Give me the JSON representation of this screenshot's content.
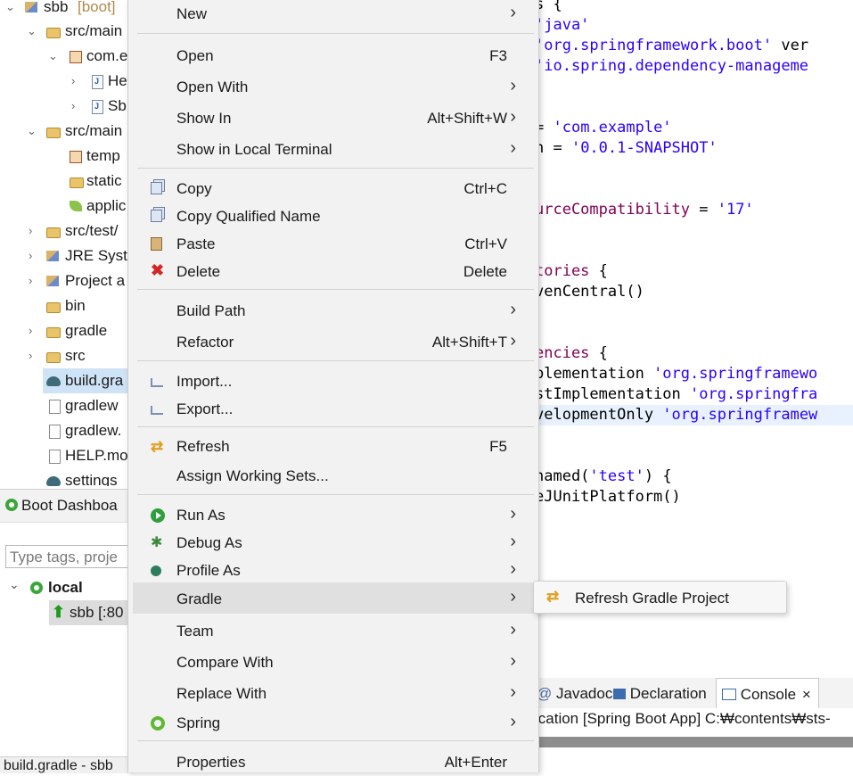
{
  "explorer": {
    "rows": [
      {
        "label": "sbb",
        "decoration": "[boot]"
      },
      {
        "label": "src/main"
      },
      {
        "label": "com.e"
      },
      {
        "label": "He"
      },
      {
        "label": "Sb"
      },
      {
        "label": "src/main"
      },
      {
        "label": "temp"
      },
      {
        "label": "static"
      },
      {
        "label": "applic"
      },
      {
        "label": "src/test/"
      },
      {
        "label": "JRE Syste"
      },
      {
        "label": "Project a"
      },
      {
        "label": "bin"
      },
      {
        "label": "gradle"
      },
      {
        "label": "src"
      },
      {
        "label": "build.gra"
      },
      {
        "label": "gradlew"
      },
      {
        "label": "gradlew."
      },
      {
        "label": "HELP.mo"
      },
      {
        "label": "settings"
      }
    ]
  },
  "boot_dashboard": {
    "title": "Boot Dashboa",
    "search_placeholder": "Type tags, proje",
    "local_label": "local",
    "app_label": "sbb [:80"
  },
  "status_left": "build.gradle - sbb",
  "editor": {
    "lines": [
      {
        "parts": [
          {
            "t": "s {",
            "c": "plain"
          }
        ]
      },
      {
        "parts": [
          {
            "t": "'java'",
            "c": "str"
          }
        ]
      },
      {
        "parts": [
          {
            "t": "'org.springframework.boot'",
            "c": "str"
          },
          {
            "t": " ver",
            "c": "plain"
          }
        ]
      },
      {
        "parts": [
          {
            "t": "'io.spring.dependency-manageme",
            "c": "str"
          }
        ]
      },
      {
        "parts": []
      },
      {
        "parts": []
      },
      {
        "parts": [
          {
            "t": "= ",
            "c": "plain"
          },
          {
            "t": "'com.example'",
            "c": "str"
          }
        ]
      },
      {
        "parts": [
          {
            "t": "n = ",
            "c": "plain"
          },
          {
            "t": "'0.0.1-SNAPSHOT'",
            "c": "str"
          }
        ]
      },
      {
        "parts": []
      },
      {
        "parts": []
      },
      {
        "parts": [
          {
            "t": "urceCompatibility",
            "c": "kw"
          },
          {
            "t": " = ",
            "c": "plain"
          },
          {
            "t": "'17'",
            "c": "str"
          }
        ]
      },
      {
        "parts": []
      },
      {
        "parts": []
      },
      {
        "parts": [
          {
            "t": "tories",
            "c": "kw"
          },
          {
            "t": " {",
            "c": "plain"
          }
        ]
      },
      {
        "parts": [
          {
            "t": "venCentral()",
            "c": "plain"
          }
        ]
      },
      {
        "parts": []
      },
      {
        "parts": []
      },
      {
        "parts": [
          {
            "t": "encies",
            "c": "kw"
          },
          {
            "t": " {",
            "c": "plain"
          }
        ]
      },
      {
        "parts": [
          {
            "t": "plementation ",
            "c": "plain"
          },
          {
            "t": "'org.springframewo",
            "c": "str"
          }
        ]
      },
      {
        "parts": [
          {
            "t": "stImplementation ",
            "c": "plain"
          },
          {
            "t": "'org.springfra",
            "c": "str"
          }
        ]
      },
      {
        "parts": [
          {
            "t": "velopmentOnly ",
            "c": "plain"
          },
          {
            "t": "'org.springframew",
            "c": "str"
          }
        ],
        "highlight": true
      },
      {
        "parts": []
      },
      {
        "parts": []
      },
      {
        "parts": [
          {
            "t": "named(",
            "c": "plain"
          },
          {
            "t": "'test'",
            "c": "str"
          },
          {
            "t": ") {",
            "c": "plain"
          }
        ]
      },
      {
        "parts": [
          {
            "t": "eJUnitPlatform()",
            "c": "plain"
          }
        ]
      }
    ]
  },
  "bottom_panel": {
    "tabs": [
      "Javadoc",
      "Declaration",
      "Console"
    ],
    "active_tab": "Console",
    "close_glyph": "×",
    "console_text": "ication [Spring Boot App] C:₩contents₩sts-"
  },
  "context_menu": {
    "items": [
      {
        "label": "New",
        "submenu": true
      },
      {
        "label": "Open",
        "shortcut": "F3"
      },
      {
        "label": "Open With",
        "submenu": true
      },
      {
        "label": "Show In",
        "shortcut": "Alt+Shift+W",
        "submenu": true
      },
      {
        "label": "Show in Local Terminal",
        "submenu": true
      },
      {
        "label": "Copy",
        "shortcut": "Ctrl+C",
        "icon": "copy-icon"
      },
      {
        "label": "Copy Qualified Name",
        "icon": "copy-qualified-icon"
      },
      {
        "label": "Paste",
        "shortcut": "Ctrl+V",
        "icon": "paste-icon"
      },
      {
        "label": "Delete",
        "shortcut": "Delete",
        "icon": "delete-icon"
      },
      {
        "label": "Build Path",
        "submenu": true
      },
      {
        "label": "Refactor",
        "shortcut": "Alt+Shift+T",
        "submenu": true
      },
      {
        "label": "Import...",
        "icon": "import-icon"
      },
      {
        "label": "Export...",
        "icon": "export-icon"
      },
      {
        "label": "Refresh",
        "shortcut": "F5",
        "icon": "refresh-icon"
      },
      {
        "label": "Assign Working Sets..."
      },
      {
        "label": "Run As",
        "submenu": true,
        "icon": "run-icon"
      },
      {
        "label": "Debug As",
        "submenu": true,
        "icon": "debug-icon"
      },
      {
        "label": "Profile As",
        "submenu": true,
        "icon": "profile-icon"
      },
      {
        "label": "Gradle",
        "submenu": true,
        "hover": true
      },
      {
        "label": "Team",
        "submenu": true
      },
      {
        "label": "Compare With",
        "submenu": true
      },
      {
        "label": "Replace With",
        "submenu": true
      },
      {
        "label": "Spring",
        "submenu": true,
        "icon": "spring-icon"
      },
      {
        "label": "Properties",
        "shortcut": "Alt+Enter"
      }
    ],
    "submenu_arrow": "›"
  },
  "gradle_submenu": {
    "items": [
      {
        "label": "Refresh Gradle Project",
        "icon": "refresh-gradle-icon"
      }
    ]
  },
  "colors": {
    "menu_bg": "#f2f2f2",
    "menu_hover": "#e0e0e0",
    "string": "#2a00ff",
    "keyword": "#7f0055",
    "selection": "#cfe3f6"
  }
}
